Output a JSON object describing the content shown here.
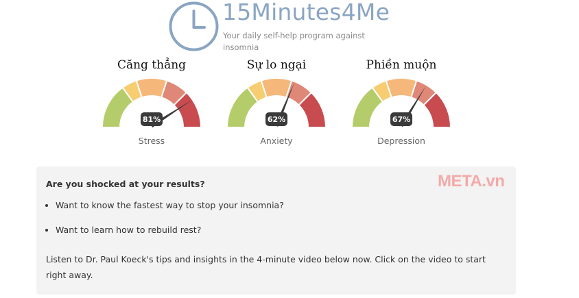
{
  "header": {
    "brand": "15Minutes4Me",
    "tagline": "Your daily self-help program against insomnia",
    "logo_icon": "clock-icon"
  },
  "gauges": [
    {
      "title": "Căng thẳng",
      "percent": 81,
      "percent_label": "81%",
      "label": "Stress"
    },
    {
      "title": "Sự lo ngại",
      "percent": 62,
      "percent_label": "62%",
      "label": "Anxiety"
    },
    {
      "title": "Phiền muộn",
      "percent": 67,
      "percent_label": "67%",
      "label": "Depression"
    }
  ],
  "gauge_colors": [
    "#b5cc6b",
    "#f7cd72",
    "#f5b87a",
    "#e08878",
    "#c84b4f"
  ],
  "panel": {
    "heading": "Are you shocked at your results?",
    "bullets": [
      "Want to know the fastest way to stop your insomnia?",
      "Want to learn how to rebuild rest?"
    ],
    "body": "Listen to Dr. Paul Koeck's tips and insights in the 4-minute video below now. Click on the video to start right away."
  },
  "watermark": "META.vn"
}
